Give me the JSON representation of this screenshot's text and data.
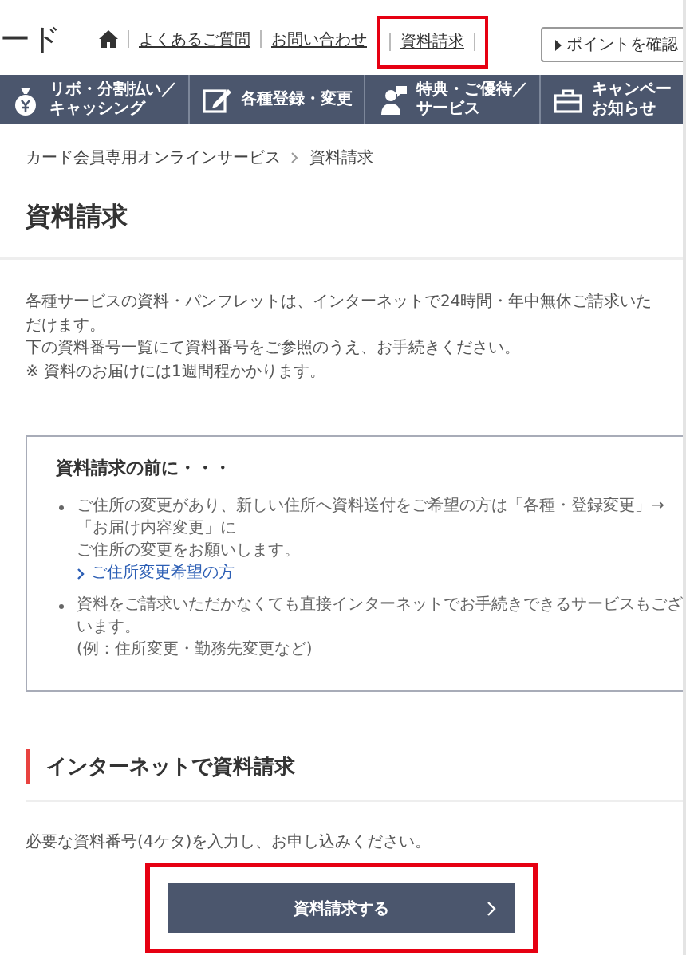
{
  "logo": {
    "text": "ード"
  },
  "header_links": [
    {
      "label": "よくあるご質問",
      "highlighted": false
    },
    {
      "label": "お問い合わせ",
      "highlighted": false
    },
    {
      "label": "資料請求",
      "highlighted": true
    }
  ],
  "points_button": {
    "label": "ポイントを確認"
  },
  "main_nav": [
    {
      "kind": "yen-bag",
      "lines": [
        "リボ・分割払い／",
        "キャッシング"
      ]
    },
    {
      "kind": "pencil",
      "lines": [
        "各種登録・変更"
      ]
    },
    {
      "kind": "person",
      "lines": [
        "特典・ご優待／",
        "サービス"
      ]
    },
    {
      "kind": "bag",
      "lines": [
        "キャンペー",
        "お知らせ"
      ]
    }
  ],
  "breadcrumb": [
    "カード会員専用オンラインサービス",
    "資料請求"
  ],
  "title": "資料請求",
  "intro": [
    "各種サービスの資料・パンフレットは、インターネットで24時間・年中無休ご請求いただけます。",
    "下の資料番号一覧にて資料番号をご参照のうえ、お手続きください。",
    "※ 資料のお届けには1週間程かかります。"
  ],
  "notice": {
    "title": "資料請求の前に・・・",
    "items": [
      {
        "lines": [
          "ご住所の変更があり、新しい住所へ資料送付をご希望の方は「各種・登録変更」→「お届け内容変更」に",
          "ご住所の変更をお願いします。"
        ],
        "link": "ご住所変更希望の方"
      },
      {
        "lines": [
          "資料をご請求いただかなくても直接インターネットでお手続きできるサービスもございます。",
          "(例：住所変更・勤務先変更など)"
        ]
      }
    ]
  },
  "section": {
    "title": "インターネットで資料請求",
    "instruction": "必要な資料番号(4ケタ)を入力し、お申し込みください。",
    "button": {
      "label": "資料請求する",
      "highlighted": true
    }
  }
}
